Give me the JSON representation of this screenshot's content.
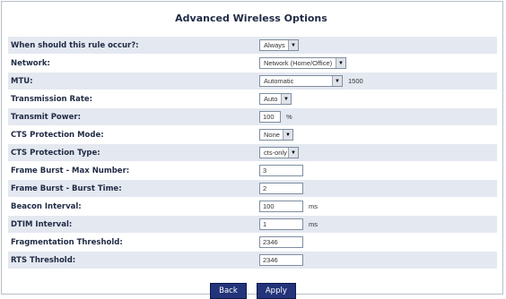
{
  "page": {
    "title": "Advanced Wireless Options"
  },
  "rows": [
    {
      "label": "When should this rule occur?:",
      "control": "select",
      "value": "Always"
    },
    {
      "label": "Network:",
      "control": "select",
      "value": "Network (Home/Office)"
    },
    {
      "label": "MTU:",
      "control": "select",
      "value": "Automatic",
      "unit": "1500"
    },
    {
      "label": "Transmission Rate:",
      "control": "select",
      "value": "Auto"
    },
    {
      "label": "Transmit Power:",
      "control": "text",
      "value": "100",
      "unit": "%"
    },
    {
      "label": "CTS Protection Mode:",
      "control": "select",
      "value": "None"
    },
    {
      "label": "CTS Protection Type:",
      "control": "select",
      "value": "cts-only"
    },
    {
      "label": "Frame Burst - Max Number:",
      "control": "text",
      "value": "3"
    },
    {
      "label": "Frame Burst - Burst Time:",
      "control": "text",
      "value": "2"
    },
    {
      "label": "Beacon Interval:",
      "control": "text",
      "value": "100",
      "unit": "ms"
    },
    {
      "label": "DTIM Interval:",
      "control": "text",
      "value": "1",
      "unit": "ms"
    },
    {
      "label": "Fragmentation Threshold:",
      "control": "text",
      "value": "2346"
    },
    {
      "label": "RTS Threshold:",
      "control": "text",
      "value": "2346"
    }
  ],
  "buttons": {
    "back": "Back",
    "apply": "Apply"
  },
  "colors": {
    "row_alt": "#e4e8f0",
    "button": "#23347a",
    "text": "#1f2a44"
  },
  "icons": {
    "dropdown": "chevron-down-icon"
  }
}
